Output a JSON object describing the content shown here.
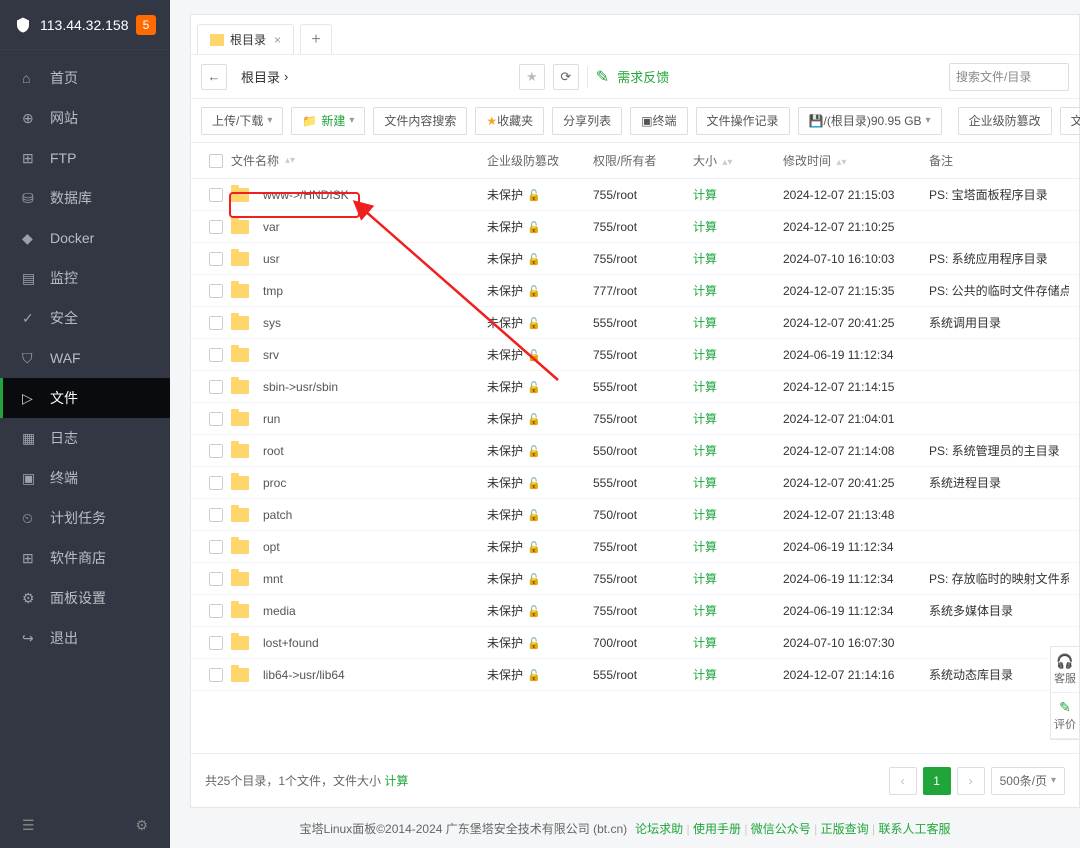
{
  "header": {
    "ip": "113.44.32.158",
    "badge": "5"
  },
  "sidebar": {
    "items": [
      {
        "label": "首页",
        "icon": "home"
      },
      {
        "label": "网站",
        "icon": "globe"
      },
      {
        "label": "FTP",
        "icon": "ftp"
      },
      {
        "label": "数据库",
        "icon": "db"
      },
      {
        "label": "Docker",
        "icon": "docker"
      },
      {
        "label": "监控",
        "icon": "monitor"
      },
      {
        "label": "安全",
        "icon": "shield"
      },
      {
        "label": "WAF",
        "icon": "waf"
      },
      {
        "label": "文件",
        "icon": "folder"
      },
      {
        "label": "日志",
        "icon": "log"
      },
      {
        "label": "终端",
        "icon": "terminal"
      },
      {
        "label": "计划任务",
        "icon": "cron"
      },
      {
        "label": "软件商店",
        "icon": "store"
      },
      {
        "label": "面板设置",
        "icon": "settings"
      },
      {
        "label": "退出",
        "icon": "exit"
      }
    ],
    "active_index": 8
  },
  "tab": {
    "label": "根目录"
  },
  "breadcrumb": {
    "root": "根目录"
  },
  "toolbar1": {
    "feedback": "需求反馈",
    "search_placeholder": "搜索文件/目录"
  },
  "toolbar2": {
    "upload": "上传/下载",
    "new": "新建",
    "content_search": "文件内容搜索",
    "favorites": "收藏夹",
    "share": "分享列表",
    "terminal": "终端",
    "oplog": "文件操作记录",
    "disk": "/(根目录)90.95 GB",
    "defense": "企业级防篡改",
    "sync": "文件同步"
  },
  "columns": {
    "name": "文件名称",
    "defense": "企业级防篡改",
    "perm": "权限/所有者",
    "size": "大小",
    "mtime": "修改时间",
    "note": "备注"
  },
  "defense_label": "未保护",
  "calc_label": "计算",
  "rows": [
    {
      "name": "www->/HNDISK",
      "perm": "755/root",
      "mtime": "2024-12-07 21:15:03",
      "note": "PS: 宝塔面板程序目录"
    },
    {
      "name": "var",
      "perm": "755/root",
      "mtime": "2024-12-07 21:10:25",
      "note": ""
    },
    {
      "name": "usr",
      "perm": "755/root",
      "mtime": "2024-07-10 16:10:03",
      "note": "PS: 系统应用程序目录"
    },
    {
      "name": "tmp",
      "perm": "777/root",
      "mtime": "2024-12-07 21:15:35",
      "note": "PS: 公共的临时文件存储点"
    },
    {
      "name": "sys",
      "perm": "555/root",
      "mtime": "2024-12-07 20:41:25",
      "note": "系统调用目录"
    },
    {
      "name": "srv",
      "perm": "755/root",
      "mtime": "2024-06-19 11:12:34",
      "note": ""
    },
    {
      "name": "sbin->usr/sbin",
      "perm": "555/root",
      "mtime": "2024-12-07 21:14:15",
      "note": ""
    },
    {
      "name": "run",
      "perm": "755/root",
      "mtime": "2024-12-07 21:04:01",
      "note": ""
    },
    {
      "name": "root",
      "perm": "550/root",
      "mtime": "2024-12-07 21:14:08",
      "note": "PS: 系统管理员的主目录"
    },
    {
      "name": "proc",
      "perm": "555/root",
      "mtime": "2024-12-07 20:41:25",
      "note": "系统进程目录"
    },
    {
      "name": "patch",
      "perm": "750/root",
      "mtime": "2024-12-07 21:13:48",
      "note": ""
    },
    {
      "name": "opt",
      "perm": "755/root",
      "mtime": "2024-06-19 11:12:34",
      "note": ""
    },
    {
      "name": "mnt",
      "perm": "755/root",
      "mtime": "2024-06-19 11:12:34",
      "note": "PS: 存放临时的映射文件系"
    },
    {
      "name": "media",
      "perm": "755/root",
      "mtime": "2024-06-19 11:12:34",
      "note": "系统多媒体目录"
    },
    {
      "name": "lost+found",
      "perm": "700/root",
      "mtime": "2024-07-10 16:07:30",
      "note": ""
    },
    {
      "name": "lib64->usr/lib64",
      "perm": "555/root",
      "mtime": "2024-12-07 21:14:16",
      "note": "系统动态库目录"
    }
  ],
  "footer_stats": {
    "summary": "共25个目录，1个文件，文件大小",
    "calc": "计算"
  },
  "pager": {
    "page": "1",
    "size": "500条/页"
  },
  "side_widget": {
    "a": "客服",
    "b": "评价"
  },
  "bottom_footer": {
    "copyright": "宝塔Linux面板©2014-2024 广东堡塔安全技术有限公司 (bt.cn)",
    "links": [
      "论坛求助",
      "使用手册",
      "微信公众号",
      "正版查询",
      "联系人工客服"
    ]
  }
}
